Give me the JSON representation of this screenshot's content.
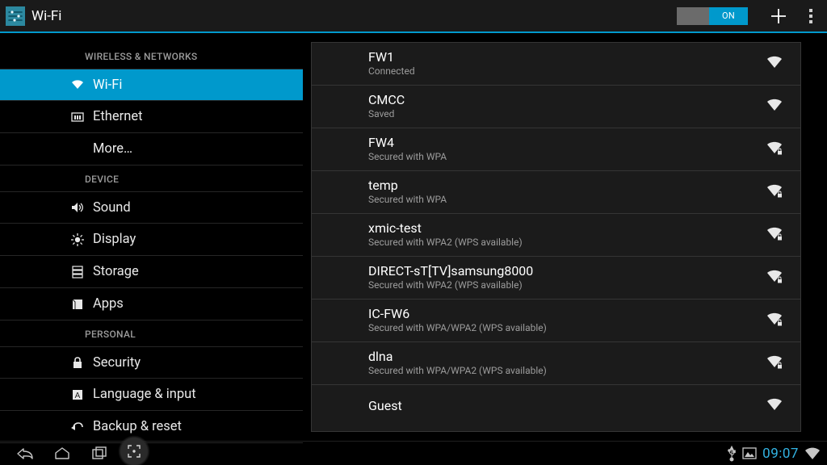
{
  "header": {
    "title": "Wi-Fi",
    "toggle_on_label": "ON"
  },
  "sidebar": {
    "sections": [
      {
        "label": "WIRELESS & NETWORKS",
        "items": [
          {
            "label": "Wi-Fi",
            "icon": "wifi-icon",
            "has_icon": true,
            "active": true
          },
          {
            "label": "Ethernet",
            "icon": "ethernet-icon",
            "has_icon": true,
            "active": false
          },
          {
            "label": "More…",
            "icon": "",
            "has_icon": false,
            "active": false
          }
        ]
      },
      {
        "label": "DEVICE",
        "items": [
          {
            "label": "Sound",
            "icon": "sound-icon",
            "has_icon": true,
            "active": false
          },
          {
            "label": "Display",
            "icon": "display-icon",
            "has_icon": true,
            "active": false
          },
          {
            "label": "Storage",
            "icon": "storage-icon",
            "has_icon": true,
            "active": false
          },
          {
            "label": "Apps",
            "icon": "apps-icon",
            "has_icon": true,
            "active": false
          }
        ]
      },
      {
        "label": "PERSONAL",
        "items": [
          {
            "label": "Security",
            "icon": "security-icon",
            "has_icon": true,
            "active": false
          },
          {
            "label": "Language & input",
            "icon": "language-icon",
            "has_icon": true,
            "active": false
          },
          {
            "label": "Backup & reset",
            "icon": "backup-icon",
            "has_icon": true,
            "active": false
          }
        ]
      }
    ]
  },
  "networks": [
    {
      "ssid": "FW1",
      "sub": "Connected",
      "secured": false
    },
    {
      "ssid": "CMCC",
      "sub": "Saved",
      "secured": false
    },
    {
      "ssid": "FW4",
      "sub": "Secured with WPA",
      "secured": true
    },
    {
      "ssid": "temp",
      "sub": "Secured with WPA",
      "secured": true
    },
    {
      "ssid": "xmic-test",
      "sub": "Secured with WPA2 (WPS available)",
      "secured": true
    },
    {
      "ssid": "DIRECT-sT[TV]samsung8000",
      "sub": "Secured with WPA2 (WPS available)",
      "secured": true
    },
    {
      "ssid": "IC-FW6",
      "sub": "Secured with WPA/WPA2 (WPS available)",
      "secured": true
    },
    {
      "ssid": "dlna",
      "sub": "Secured with WPA/WPA2 (WPS available)",
      "secured": true
    },
    {
      "ssid": "Guest",
      "sub": "",
      "secured": false
    }
  ],
  "statusbar": {
    "clock": "09:07"
  }
}
